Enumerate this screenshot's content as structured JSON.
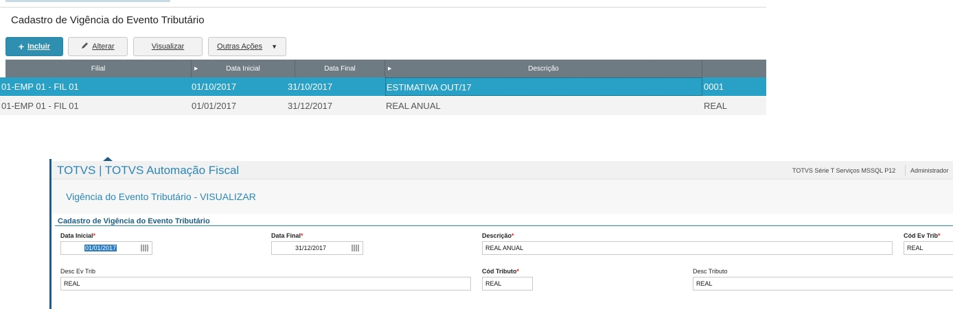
{
  "list": {
    "title": "Cadastro de Vigência do Evento Tributário",
    "toolbar": {
      "incluir": "Incluir",
      "alterar": "Alterar",
      "visualizar": "Visualizar",
      "outras": "Outras Ações"
    },
    "columns": [
      "Filial",
      "Data Inicial",
      "Data Final",
      "Descrição",
      ""
    ],
    "rows": [
      {
        "filial": "01-EMP 01 - FIL 01",
        "data_inicial": "01/10/2017",
        "data_final": "31/10/2017",
        "descricao": "ESTIMATIVA OUT/17",
        "codigo": "0001",
        "selected": true
      },
      {
        "filial": "01-EMP 01 - FIL 01",
        "data_inicial": "01/01/2017",
        "data_final": "31/12/2017",
        "descricao": "REAL ANUAL",
        "codigo": "REAL",
        "selected": false
      }
    ]
  },
  "form": {
    "app_title": "TOTVS | TOTVS Automação Fiscal",
    "environment": "TOTVS Série T Serviços MSSQL P12",
    "user": "Administrador",
    "view_title": "Vigência do Evento Tributário - VISUALIZAR",
    "section_title": "Cadastro de Vigência do Evento Tributário",
    "required_mark": "*",
    "fields": {
      "data_inicial": {
        "label": "Data Inicial",
        "value": "01/01/2017"
      },
      "data_final": {
        "label": "Data Final",
        "value": "31/12/2017"
      },
      "descricao": {
        "label": "Descrição",
        "value": "REAL ANUAL"
      },
      "cod_ev_trib": {
        "label": "Cód Ev Trib",
        "value": "REAL"
      },
      "desc_ev_trib": {
        "label": "Desc Ev Trib",
        "value": "REAL"
      },
      "cod_tributo": {
        "label": "Cód Tributo",
        "value": "REAL"
      },
      "desc_tributo": {
        "label": "Desc Tributo",
        "value": "REAL"
      }
    }
  },
  "colors": {
    "accent": "#29a0c6",
    "header_gray": "#6e7b82",
    "title_blue": "#2a86b4",
    "required_red": "#e0262a"
  }
}
